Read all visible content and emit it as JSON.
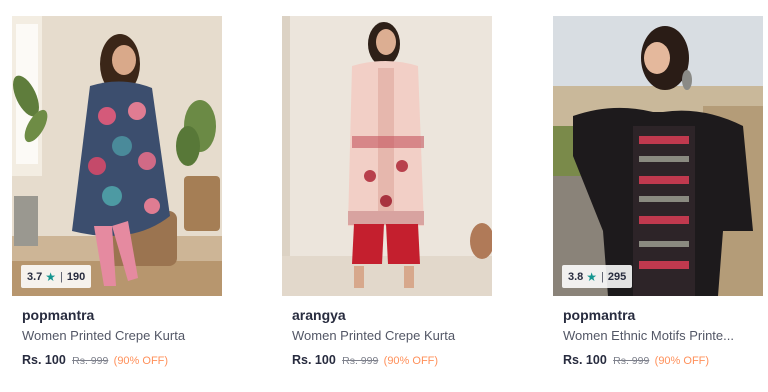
{
  "colors": {
    "rating_star": "#14958f",
    "discount": "#ff905a",
    "brand_text": "#282c3f",
    "name_text": "#535766",
    "mrp_text": "#7e818c"
  },
  "products": [
    {
      "brand": "popmantra",
      "name": "Women Printed Crepe Kurta",
      "price": "Rs. 100",
      "mrp": "Rs. 999",
      "discount": "(90% OFF)",
      "rating": {
        "value": "3.7",
        "separator": "|",
        "count": "190"
      },
      "star_icon": "★"
    },
    {
      "brand": "arangya",
      "name": "Women Printed Crepe Kurta",
      "price": "Rs. 100",
      "mrp": "Rs. 999",
      "discount": "(90% OFF)"
    },
    {
      "brand": "popmantra",
      "name": "Women Ethnic Motifs Printe...",
      "price": "Rs. 100",
      "mrp": "Rs. 999",
      "discount": "(90% OFF)",
      "rating": {
        "value": "3.8",
        "separator": "|",
        "count": "295"
      },
      "star_icon": "★"
    }
  ]
}
